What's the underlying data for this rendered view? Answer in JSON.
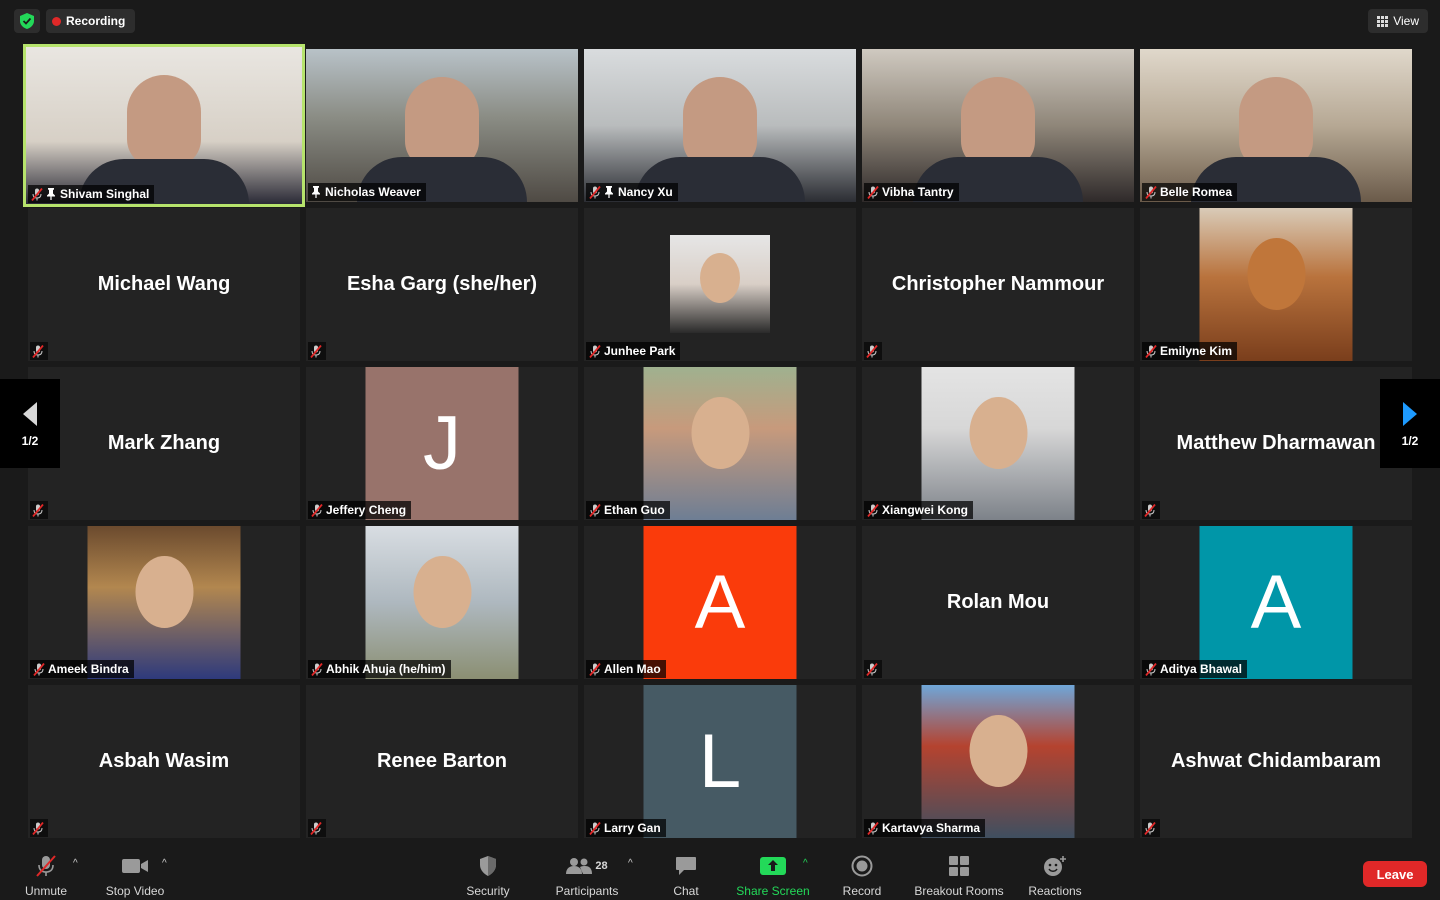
{
  "topbar": {
    "recording_label": "Recording",
    "view_label": "View"
  },
  "participants": [
    {
      "name": "Shivam Singhal",
      "type": "video",
      "muted": true,
      "pinned": true,
      "active": true
    },
    {
      "name": "Nicholas Weaver",
      "type": "video",
      "muted": false,
      "pinned": true
    },
    {
      "name": "Nancy Xu",
      "type": "video",
      "muted": true,
      "pinned": true
    },
    {
      "name": "Vibha Tantry",
      "type": "video",
      "muted": true
    },
    {
      "name": "Belle Romea",
      "type": "video",
      "muted": true
    },
    {
      "name": "Michael Wang",
      "type": "name",
      "muted": true
    },
    {
      "name": "Esha Garg (she/her)",
      "type": "name",
      "muted": true
    },
    {
      "name": "Junhee Park",
      "type": "photo",
      "muted": true
    },
    {
      "name": "Christopher Nammour",
      "type": "name",
      "muted": true
    },
    {
      "name": "Emilyne Kim",
      "type": "photo",
      "muted": true
    },
    {
      "name": "Mark Zhang",
      "type": "name",
      "muted": true
    },
    {
      "name": "Jeffery Cheng",
      "type": "avatar",
      "initial": "J",
      "color": "#98736b",
      "muted": true
    },
    {
      "name": "Ethan Guo",
      "type": "photo",
      "muted": true
    },
    {
      "name": "Xiangwei Kong",
      "type": "photo",
      "muted": true
    },
    {
      "name": "Matthew Dharmawan",
      "type": "name",
      "muted": true
    },
    {
      "name": "Ameek Bindra",
      "type": "photo",
      "muted": true
    },
    {
      "name": "Abhik Ahuja (he/him)",
      "type": "photo",
      "muted": true
    },
    {
      "name": "Allen Mao",
      "type": "avatar",
      "initial": "A",
      "color": "#fa3b0b",
      "muted": true
    },
    {
      "name": "Rolan Mou",
      "type": "name",
      "muted": true
    },
    {
      "name": "Aditya Bhawal",
      "type": "avatar",
      "initial": "A",
      "color": "#0096a8",
      "muted": true
    },
    {
      "name": "Asbah Wasim",
      "type": "name",
      "muted": true
    },
    {
      "name": "Renee Barton",
      "type": "name",
      "muted": true
    },
    {
      "name": "Larry Gan",
      "type": "avatar",
      "initial": "L",
      "color": "#465a64",
      "muted": true
    },
    {
      "name": "Kartavya Sharma",
      "type": "photo",
      "muted": true
    },
    {
      "name": "Ashwat Chidambaram",
      "type": "name",
      "muted": true
    }
  ],
  "pager": {
    "left_label": "1/2",
    "right_label": "1/2"
  },
  "toolbar": {
    "unmute": "Unmute",
    "stop_video": "Stop Video",
    "security": "Security",
    "participants": "Participants",
    "participant_count": "28",
    "chat": "Chat",
    "share_screen": "Share Screen",
    "record": "Record",
    "breakout_rooms": "Breakout Rooms",
    "reactions": "Reactions",
    "leave": "Leave"
  },
  "colors": {
    "active_speaker": "#b6e36c",
    "leave": "#e02828",
    "share": "#23d959"
  }
}
